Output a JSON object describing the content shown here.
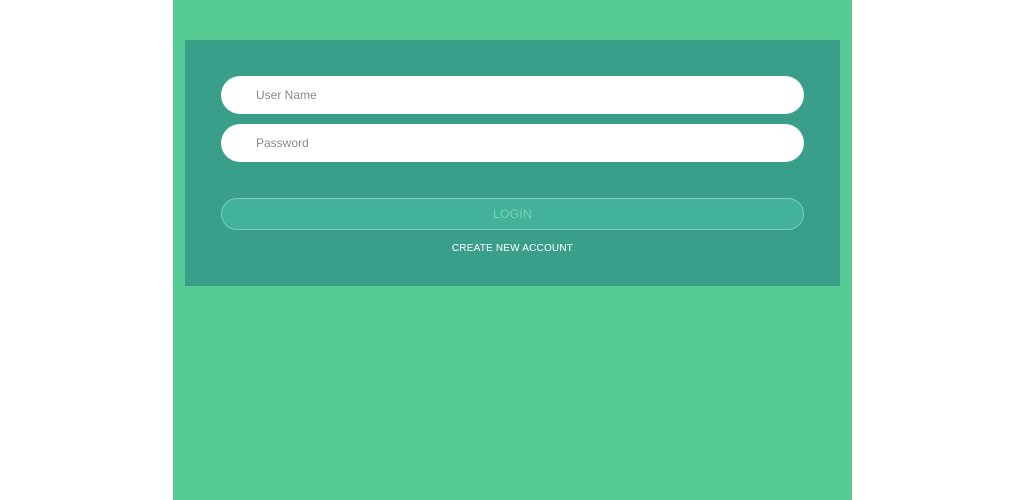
{
  "colors": {
    "background": "#FFFFFF",
    "page_green": "#56CB94",
    "card_green": "#3A9F8A",
    "button_green": "#42B29A",
    "button_text": "#7ED2BD"
  },
  "login_form": {
    "username_placeholder": "User Name",
    "username_value": "",
    "password_placeholder": "Password",
    "password_value": "",
    "login_label": "LOGIN",
    "create_account_label": "CREATE NEW ACCOUNT"
  }
}
